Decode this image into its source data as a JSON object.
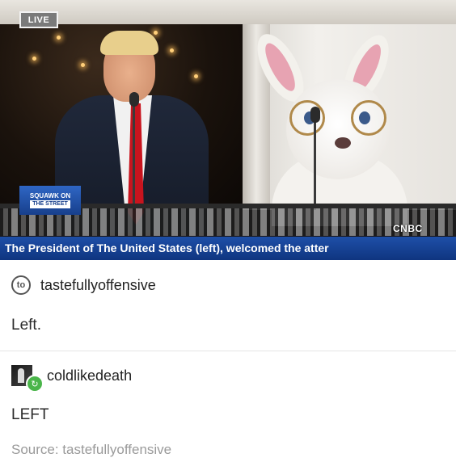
{
  "video": {
    "live_label": "LIVE",
    "show_logo_top": "SQUAWK ON",
    "show_logo_bottom": "THE STREET",
    "network_label": "CNBC",
    "chyron_text": "The President of The United States (left), welcomed the atter"
  },
  "posts": [
    {
      "username": "tastefullyoffensive",
      "avatar_text": "to",
      "body": "Left."
    },
    {
      "username": "coldlikedeath",
      "body": "LEFT"
    }
  ],
  "source": {
    "text": "Source: tastefullyoffensive"
  },
  "colors": {
    "chyron_blue": "#1e4fa8",
    "reblog_green": "#4ab54a",
    "tie_red": "#c8141e"
  }
}
